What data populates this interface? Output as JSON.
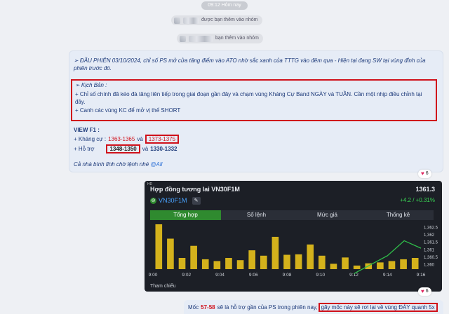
{
  "timestamp": "09:12 Hôm nay",
  "system_messages": [
    {
      "text": "được bạn thêm vào nhóm"
    },
    {
      "text": "bạn thêm vào nhóm"
    }
  ],
  "message": {
    "headline": "➢ ĐẦU PHIÊN 03/10/2024, chỉ số PS mở cửa tăng điểm vào ATO nhờ sắc xanh của TTTG vào đêm qua - Hiện tại đang SW tại vùng đỉnh của phiên trước đó.",
    "scenario_title": "➢ Kịch Bản :",
    "scenario_line1": "+ Chỉ số chính đã kéo đà tăng liên tiếp trong giai đoạn gần đây và chạm vùng Kháng Cự Band NGÀY và TUẦN. Cần một nhịp điều chỉnh tại đây.",
    "scenario_line2": "+ Canh các vùng KC để mở vị thế SHORT",
    "view_title": "VIEW F1 :",
    "resistance_label": "+ Kháng cự :",
    "resistance_1": "1363-1365",
    "resistance_and": "và",
    "resistance_2": "1373-1375",
    "support_label": "+ Hỗ trợ",
    "support_1": "1348-1350",
    "support_and": "và",
    "support_2": "1330-1332",
    "closing": "Cả nhà bình tĩnh chờ lệnh nhé",
    "mention": "@All",
    "reaction_count": "6"
  },
  "chart_card": {
    "hd": "HD",
    "title": "Hợp đồng tương lai VN30F1M",
    "price": "1361.3",
    "symbol": "VN30F1M",
    "change": "+4.2 / +0.31%",
    "tabs": [
      "Tổng hợp",
      "Sổ lệnh",
      "Mức giá",
      "Thống kê"
    ],
    "footer": "Tham chiếu",
    "reaction_count": "6",
    "colors": {
      "bar": "#d4b21c",
      "line": "#2fbf4a",
      "active_tab": "#2f8a2f",
      "change": "#39d353"
    }
  },
  "chart_data": {
    "type": "bar",
    "x": [
      "9:00",
      "9:02",
      "9:04",
      "9:06",
      "9:08",
      "9:10",
      "9:12",
      "9:14",
      "9:16"
    ],
    "bar_values": [
      1.0,
      0.68,
      0.25,
      0.52,
      0.22,
      0.18,
      0.25,
      0.2,
      0.42,
      0.3,
      0.72,
      0.32,
      0.33,
      0.55,
      0.3,
      0.12,
      0.26,
      0.08,
      0.13,
      0.15,
      0.18,
      0.22,
      0.25
    ],
    "price_line": {
      "x": [
        "9:12",
        "9:13",
        "9:14",
        "9:15",
        "9:16"
      ],
      "y": [
        1359.4,
        1360.0,
        1360.6,
        1361.6,
        1361.1
      ]
    },
    "y_ticks": [
      "1,362.5",
      "1,362",
      "1,361.5",
      "1,361",
      "1,360.5",
      "1,360"
    ],
    "ylim": [
      1359.7,
      1362.7
    ]
  },
  "bottom_message": {
    "text_start": "Mốc",
    "highlight": "57-58",
    "text_mid": "sẽ là hỗ trợ gần của PS trong phiên nay,",
    "boxed": "gãy mốc này sẽ rơi lại về vùng ĐÁY quanh 5x"
  }
}
